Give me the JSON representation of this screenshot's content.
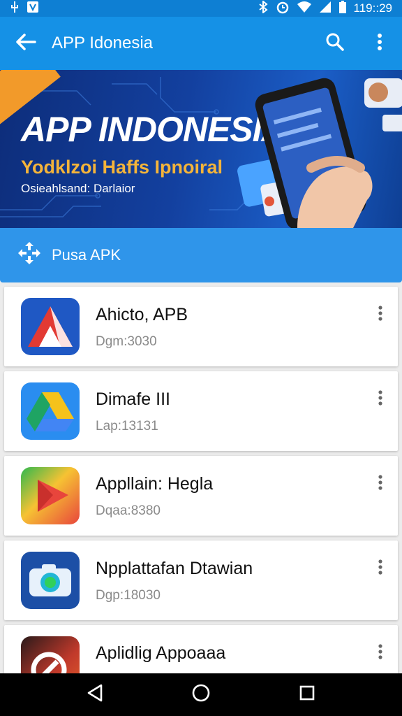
{
  "status_bar": {
    "time": "119::29"
  },
  "app_bar": {
    "title": "APP Idonesia"
  },
  "banner": {
    "title": "APP INDONESIA",
    "subtitle": "Yodklzoi Haffs Ipnoiral",
    "tagline": "Osieahlsand: Darlaior"
  },
  "section": {
    "label": "Pusa APK"
  },
  "apps": [
    {
      "name": "Ahicto, APB",
      "detail": "Dgm:3030"
    },
    {
      "name": "Dimafe III",
      "detail": "Lap:13131"
    },
    {
      "name": "Appllain: Hegla",
      "detail": "Dqaa:8380"
    },
    {
      "name": "Npplattafan Dtawian",
      "detail": "Dgp:18030"
    },
    {
      "name": "Aplidlig Appoaaa",
      "detail": ""
    }
  ],
  "colors": {
    "status_bar": "#0e7fd3",
    "app_bar": "#1591e6",
    "section": "#2f95ea"
  },
  "icons": [
    "back-arrow-icon",
    "search-icon",
    "more-vert-icon",
    "pusa-logo-icon",
    "back-triangle-icon",
    "home-circle-icon",
    "recents-square-icon"
  ]
}
